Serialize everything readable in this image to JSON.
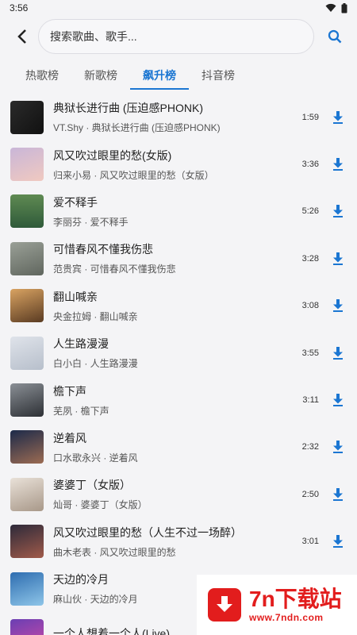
{
  "status_bar": {
    "time": "3:56"
  },
  "search": {
    "placeholder": "搜索歌曲、歌手..."
  },
  "tabs": [
    {
      "label": "热歌榜",
      "active": false
    },
    {
      "label": "新歌榜",
      "active": false
    },
    {
      "label": "飙升榜",
      "active": true
    },
    {
      "label": "抖音榜",
      "active": false
    }
  ],
  "songs": [
    {
      "title": "典狱长进行曲 (压迫感PHONK)",
      "subtitle": "VT.Shy · 典狱长进行曲 (压迫感PHONK)",
      "duration": "1:59"
    },
    {
      "title": "风又吹过眼里的愁(女版)",
      "subtitle": "归来小易 · 风又吹过眼里的愁（女版）",
      "duration": "3:36"
    },
    {
      "title": "爱不释手",
      "subtitle": "李丽芬 · 爱不释手",
      "duration": "5:26"
    },
    {
      "title": "可惜春风不懂我伤悲",
      "subtitle": "范贵宾 · 可惜春风不懂我伤悲",
      "duration": "3:28"
    },
    {
      "title": "翻山喊亲",
      "subtitle": "央金拉姆 · 翻山喊亲",
      "duration": "3:08"
    },
    {
      "title": "人生路漫漫",
      "subtitle": "白小白 · 人生路漫漫",
      "duration": "3:55"
    },
    {
      "title": "檐下声",
      "subtitle": "芜夙 · 檐下声",
      "duration": "3:11"
    },
    {
      "title": "逆着风",
      "subtitle": "口水歌永兴 · 逆着风",
      "duration": "2:32"
    },
    {
      "title": "婆婆丁（女版）",
      "subtitle": "灿哥 · 婆婆丁（女版）",
      "duration": "2:50"
    },
    {
      "title": "风又吹过眼里的愁（人生不过一场醉）",
      "subtitle": "曲木老表 · 风又吹过眼里的愁",
      "duration": "3:01"
    },
    {
      "title": "天边的冷月",
      "subtitle": "麻山伙 · 天边的冷月",
      "duration": ""
    },
    {
      "title": "一个人想着一个人(Live)",
      "subtitle": "",
      "duration": ""
    }
  ],
  "watermark": {
    "name": "7n下载站",
    "url": "www.7ndn.com"
  },
  "colors": {
    "accent": "#1b76d2",
    "watermark": "#e21d1d"
  }
}
